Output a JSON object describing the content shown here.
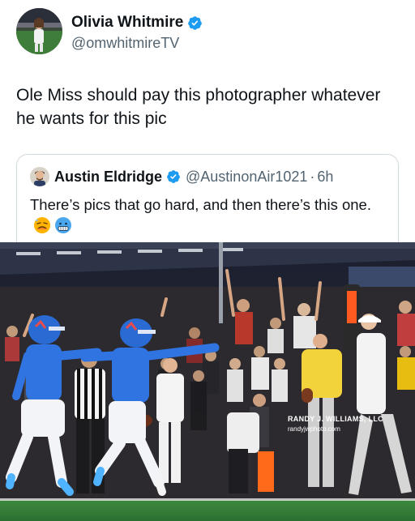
{
  "post": {
    "author_name": "Olivia Whitmire",
    "author_handle": "@omwhitmireTV",
    "verified_icon": "verified-badge-icon",
    "text": "Ole Miss should pay this photographer whatever he wants for this pic"
  },
  "quoted_post": {
    "author_name": "Austin Eldridge",
    "author_handle": "@AustinonAir1021",
    "separator": "·",
    "time": "6h",
    "text": "There’s pics that go hard, and then there’s this one.",
    "emojis": [
      "hot-face-emoji",
      "cold-face-emoji"
    ]
  },
  "photo": {
    "credit_line_1": "RANDY J. WILLIAMS, LLC",
    "credit_line_2": "randyjwphoto.com"
  },
  "colors": {
    "verified": "#1d9bf0",
    "text": "#0f1419",
    "secondary_text": "#536471",
    "border": "#cfd9de",
    "ole_miss_blue": "#2a6bd3",
    "field_green": "#2f7a3a"
  }
}
